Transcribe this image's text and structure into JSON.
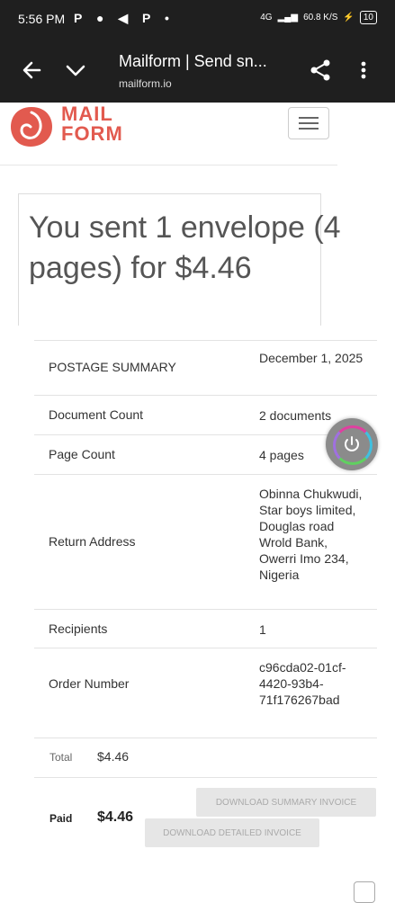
{
  "status_bar": {
    "time": "5:56 PM",
    "app_icons": "P ● ◀ P •",
    "network": "4G",
    "speed": "60.8 K/S",
    "battery": "10"
  },
  "browser": {
    "title": "Mailform | Send sn...",
    "url": "mailform.io",
    "icons": [
      "back-arrow-icon",
      "chevron-down-icon",
      "share-icon",
      "more-vert-icon"
    ]
  },
  "site": {
    "logo_line1": "MAIL",
    "logo_line2": "FORM",
    "logo_color": "#e25a4f"
  },
  "heading": "You sent 1 envelope (4 pages) for $4.46",
  "summary": [
    {
      "label": "POSTAGE SUMMARY",
      "value": "December 1, 2025"
    },
    {
      "label": "Document Count",
      "value": "2 documents"
    },
    {
      "label": "Page Count",
      "value": "4 pages"
    },
    {
      "label": "Return Address",
      "value": "Obinna Chukwudi, Star boys limited, Douglas road Wrold Bank, Owerri Imo 234, Nigeria"
    },
    {
      "label": "Recipients",
      "value": "1"
    },
    {
      "label": "Order Number",
      "value": "c96cda02-01cf-4420-93b4-71f176267bad"
    }
  ],
  "totals": {
    "total_label": "Total",
    "total_value": "$4.46",
    "paid_label": "Paid",
    "paid_value": "$4.46"
  },
  "buttons": {
    "download_summary": "DOWNLOAD SUMMARY INVOICE",
    "download_detailed": "DOWNLOAD DETAILED INVOICE"
  }
}
